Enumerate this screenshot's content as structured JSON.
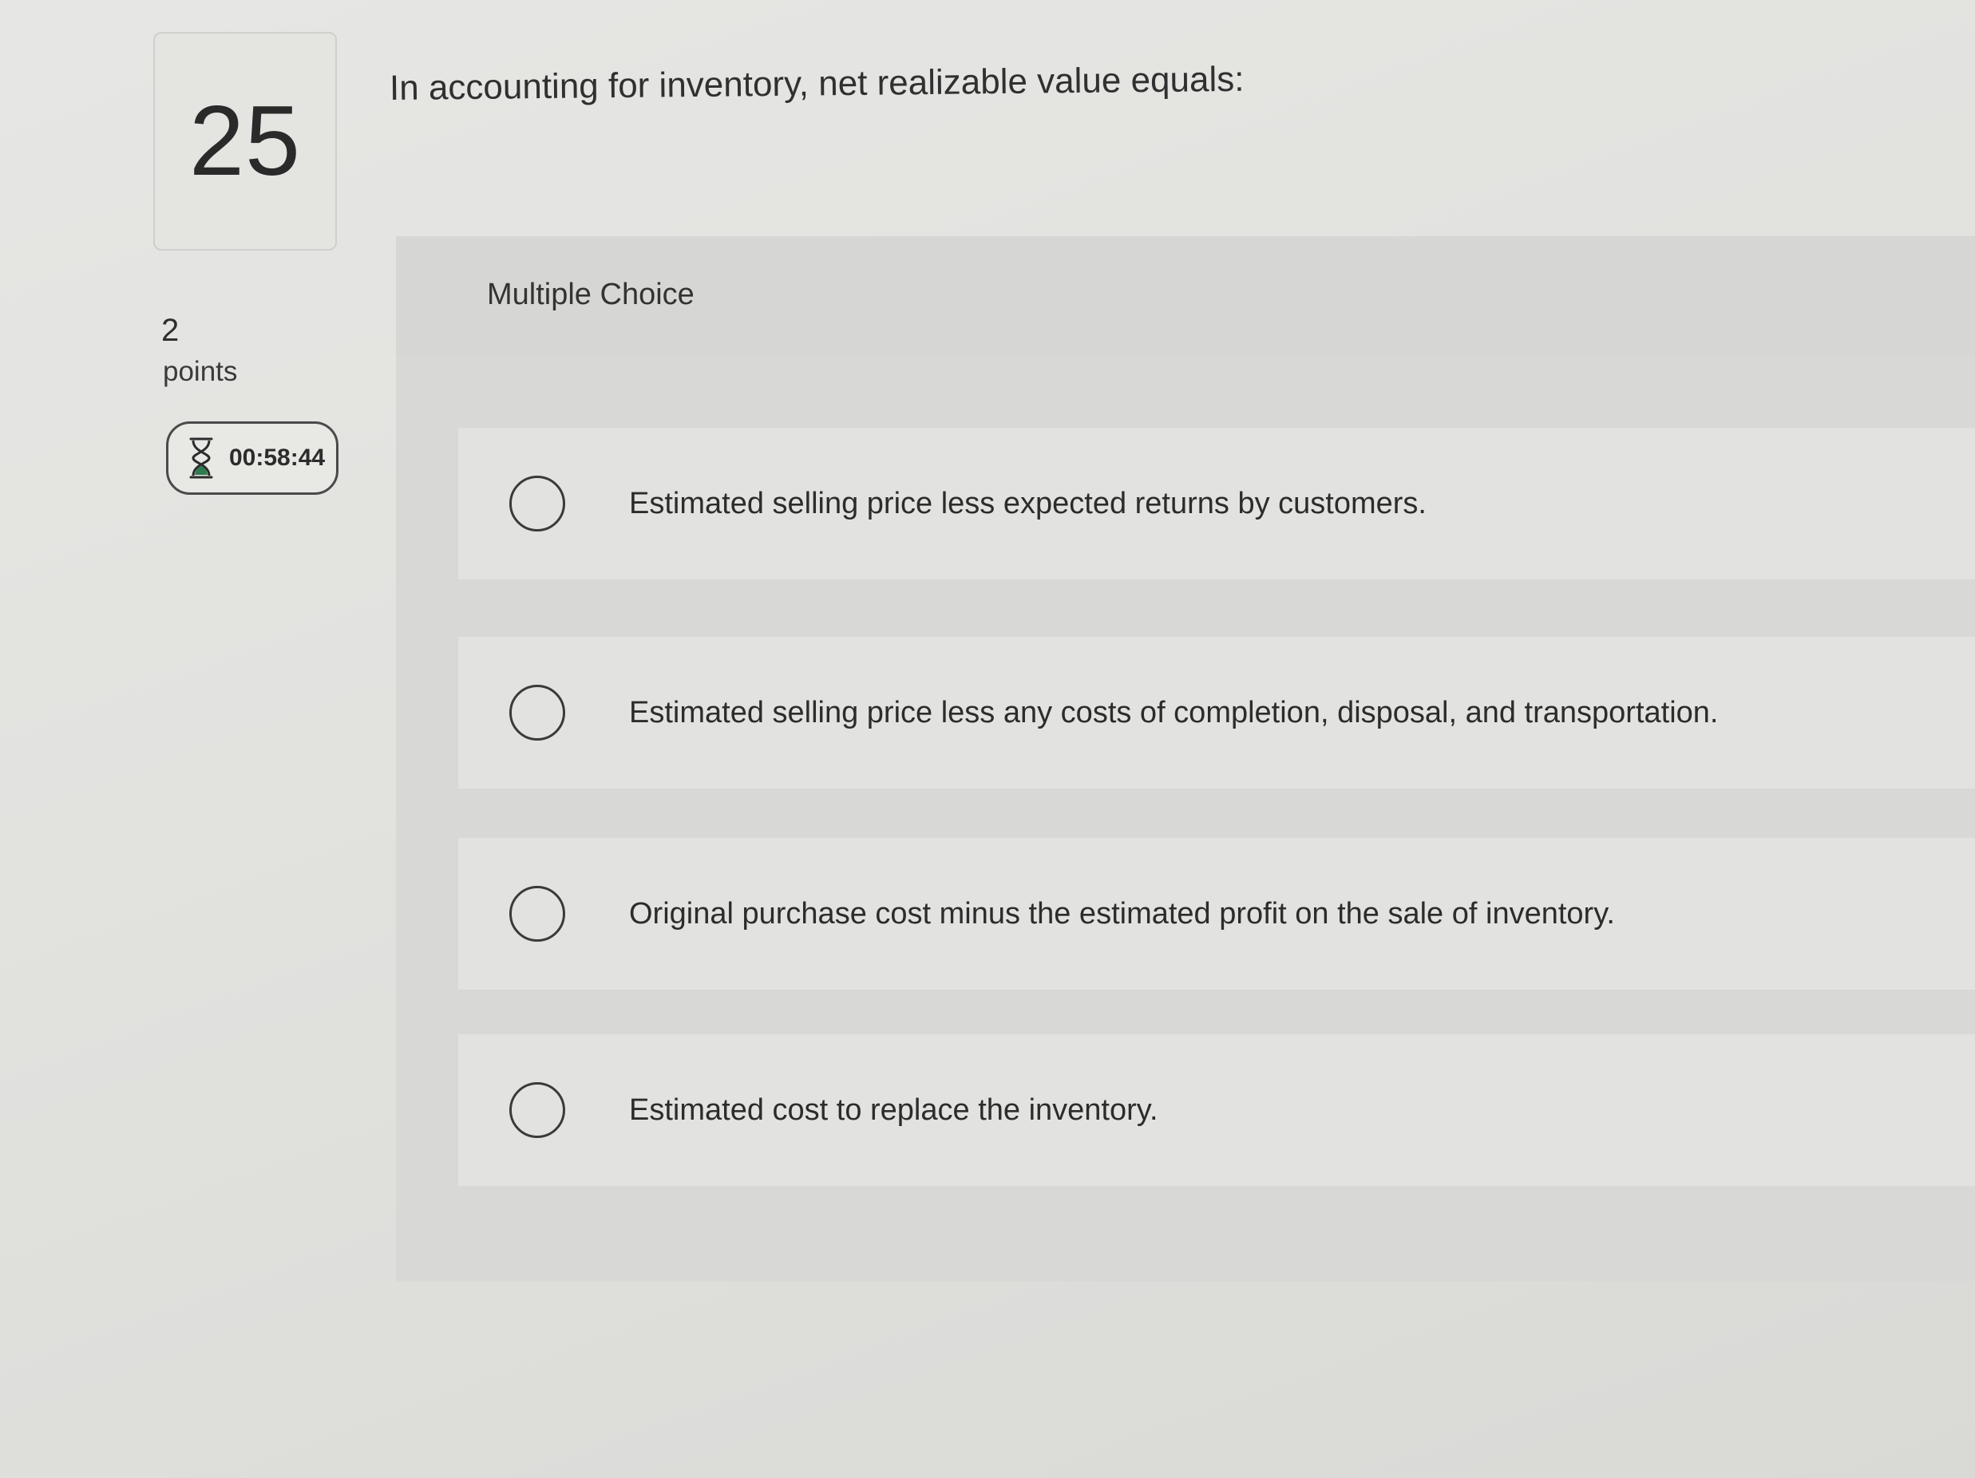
{
  "question": {
    "number": "25",
    "text": "In accounting for inventory, net realizable value equals:"
  },
  "points": {
    "value": "2",
    "label": "points"
  },
  "timer": {
    "icon": "hourglass-icon",
    "time": "00:58:44"
  },
  "multiple_choice": {
    "label": "Multiple Choice",
    "options": [
      {
        "label": "Estimated selling price less expected returns by customers.",
        "selected": false
      },
      {
        "label": "Estimated selling price less any costs of completion, disposal, and transportation.",
        "selected": false
      },
      {
        "label": "Original purchase cost minus the estimated profit on the sale of inventory.",
        "selected": false
      },
      {
        "label": "Estimated cost to replace the inventory.",
        "selected": false
      }
    ]
  },
  "colors": {
    "background": "#e2e2df",
    "panel": "#d8d9d6",
    "option_background": "#e2e3e0",
    "timer_icon": "#2f7a4f",
    "text": "#2c2c2c"
  }
}
